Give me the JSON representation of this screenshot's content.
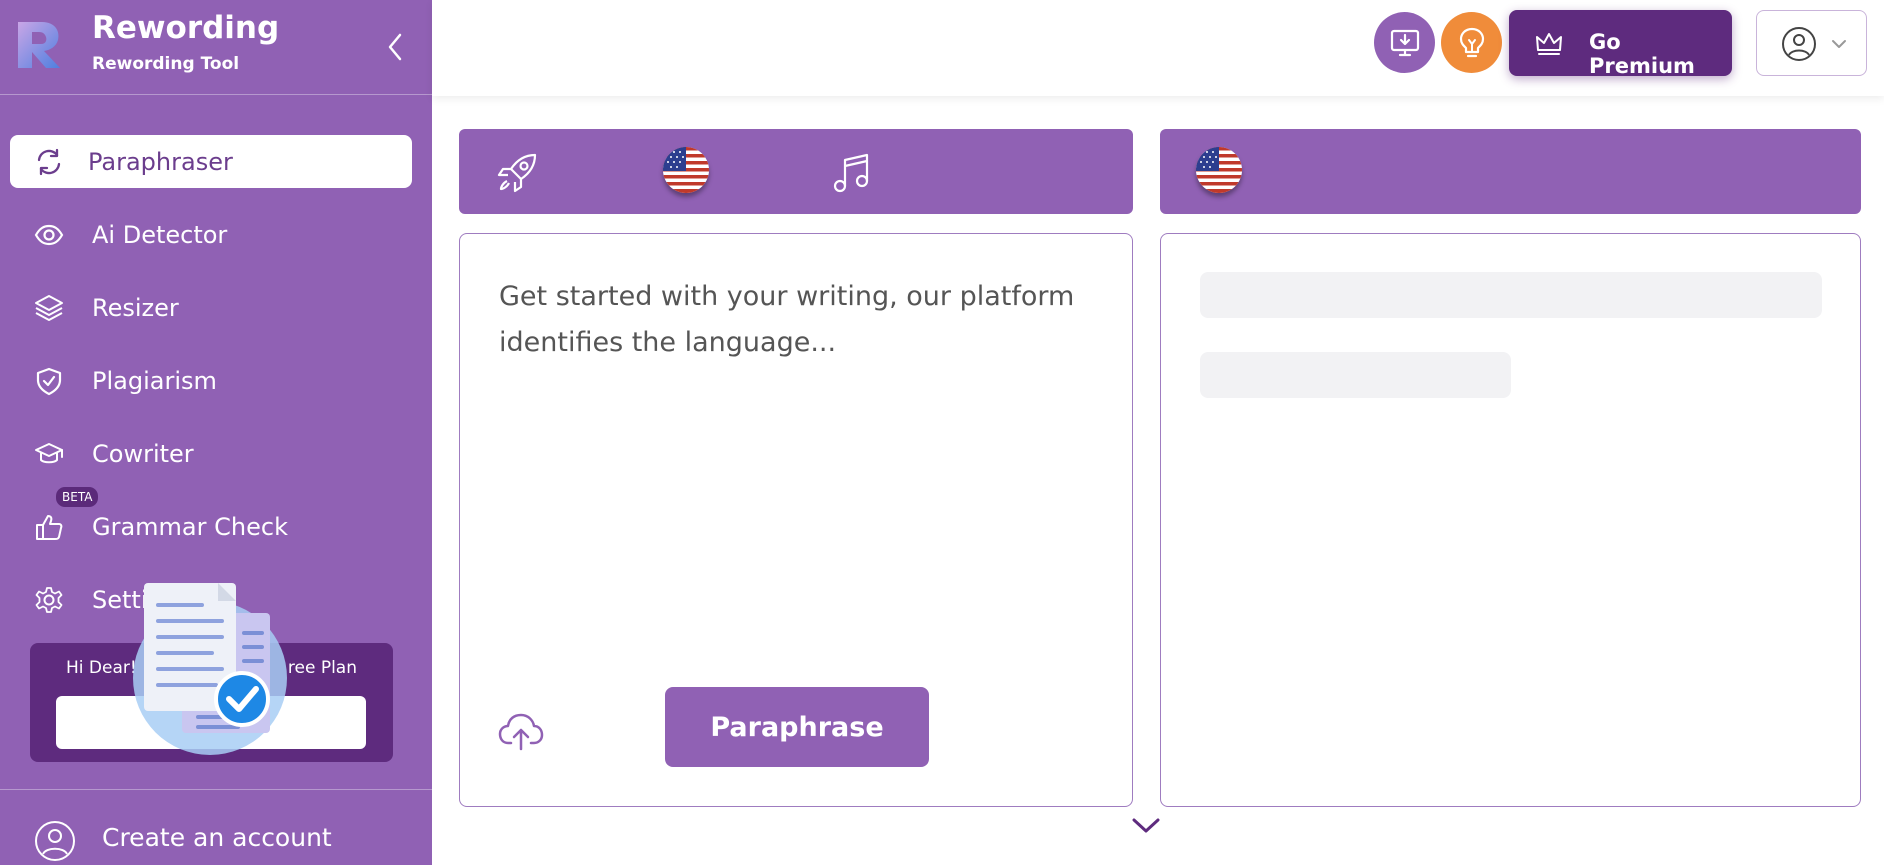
{
  "brand": {
    "name": "Rewording",
    "subtitle": "Rewording Tool"
  },
  "sidebar": {
    "items": [
      {
        "label": "Paraphraser",
        "icon": "refresh-icon",
        "active": true
      },
      {
        "label": "Ai Detector",
        "icon": "eye-icon"
      },
      {
        "label": "Resizer",
        "icon": "layers-icon"
      },
      {
        "label": "Plagiarism",
        "icon": "shield-check-icon"
      },
      {
        "label": "Cowriter",
        "icon": "graduation-cap-icon"
      },
      {
        "label": "Grammar Check",
        "icon": "thumbs-up-icon",
        "badge": "BETA"
      },
      {
        "label": "Setti",
        "icon": "gear-icon"
      }
    ],
    "plan": {
      "greeting": "Hi Dear!",
      "plan_name": "ree Plan",
      "button_label": ""
    },
    "create_account": "Create an account"
  },
  "header": {
    "premium_label": "Go Premium"
  },
  "editor": {
    "placeholder": "Get started with your writing, our platform identifies the language...",
    "paraphrase_label": "Paraphrase"
  },
  "colors": {
    "purple": "#9061b4",
    "dark_purple": "#5e2b7e",
    "orange": "#f08c3a"
  }
}
